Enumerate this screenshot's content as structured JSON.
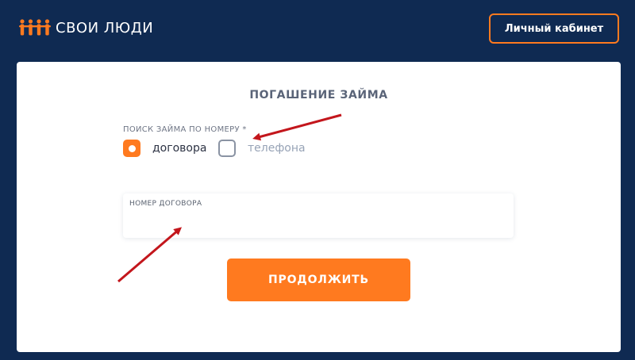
{
  "header": {
    "logo_text": "СВОИ ЛЮДИ",
    "cabinet_button": "Личный кабинет"
  },
  "form": {
    "title": "ПОГАШЕНИЕ ЗАЙМА",
    "search_label": "ПОИСК ЗАЙМА ПО НОМЕРУ *",
    "options": [
      {
        "label": "договора",
        "checked": true
      },
      {
        "label": "телефона",
        "checked": false
      }
    ],
    "field_label": "НОМЕР ДОГОВОРА",
    "field_value": "",
    "submit_label": "ПРОДОЛЖИТЬ"
  },
  "colors": {
    "background": "#0f2a52",
    "accent": "#ff7a1f",
    "annotation_arrow": "#c3161c"
  },
  "icons": {
    "logo": "people-group-logo-icon",
    "annotation": "red-arrow-icon"
  }
}
